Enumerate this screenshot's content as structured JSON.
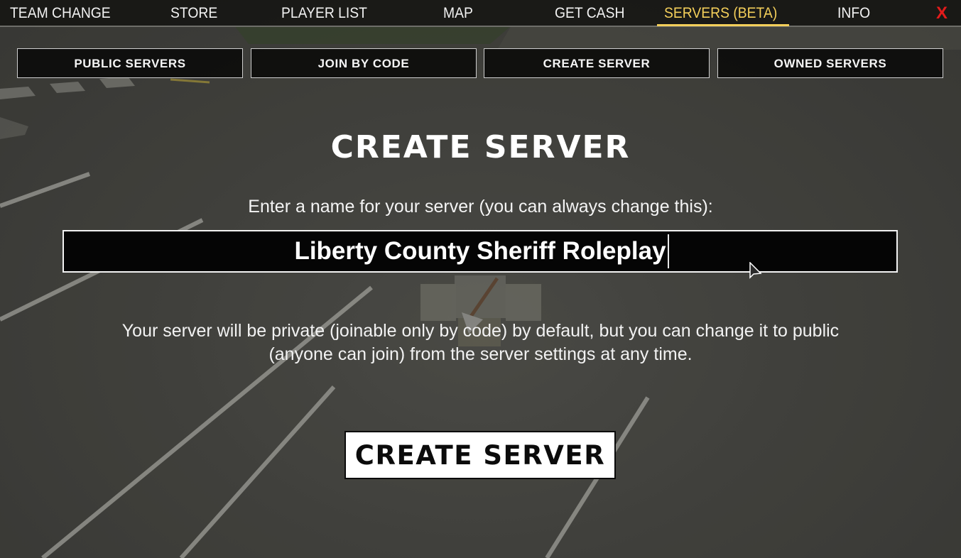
{
  "nav": {
    "items": [
      {
        "label": "TEAM CHANGE",
        "active": false
      },
      {
        "label": "STORE",
        "active": false
      },
      {
        "label": "PLAYER LIST",
        "active": false
      },
      {
        "label": "MAP",
        "active": false
      },
      {
        "label": "GET CASH",
        "active": false
      },
      {
        "label": "SERVERS (BETA)",
        "active": true
      },
      {
        "label": "INFO",
        "active": false
      }
    ],
    "close_label": "X",
    "active_color": "#f4cf5a",
    "close_color": "#e31b1b"
  },
  "subtabs": [
    {
      "label": "PUBLIC SERVERS"
    },
    {
      "label": "JOIN BY CODE"
    },
    {
      "label": "CREATE SERVER"
    },
    {
      "label": "OWNED SERVERS"
    }
  ],
  "main": {
    "title": "CREATE SERVER",
    "prompt": "Enter a name for your server (you can always change this):",
    "server_name_value": "Liberty County Sheriff Roleplay",
    "notice_line1": "Your server will be private (joinable only by code) by default, but you can change it to public",
    "notice_line2": "(anyone can join) from the server settings at any time.",
    "create_button_label": "CREATE SERVER"
  }
}
